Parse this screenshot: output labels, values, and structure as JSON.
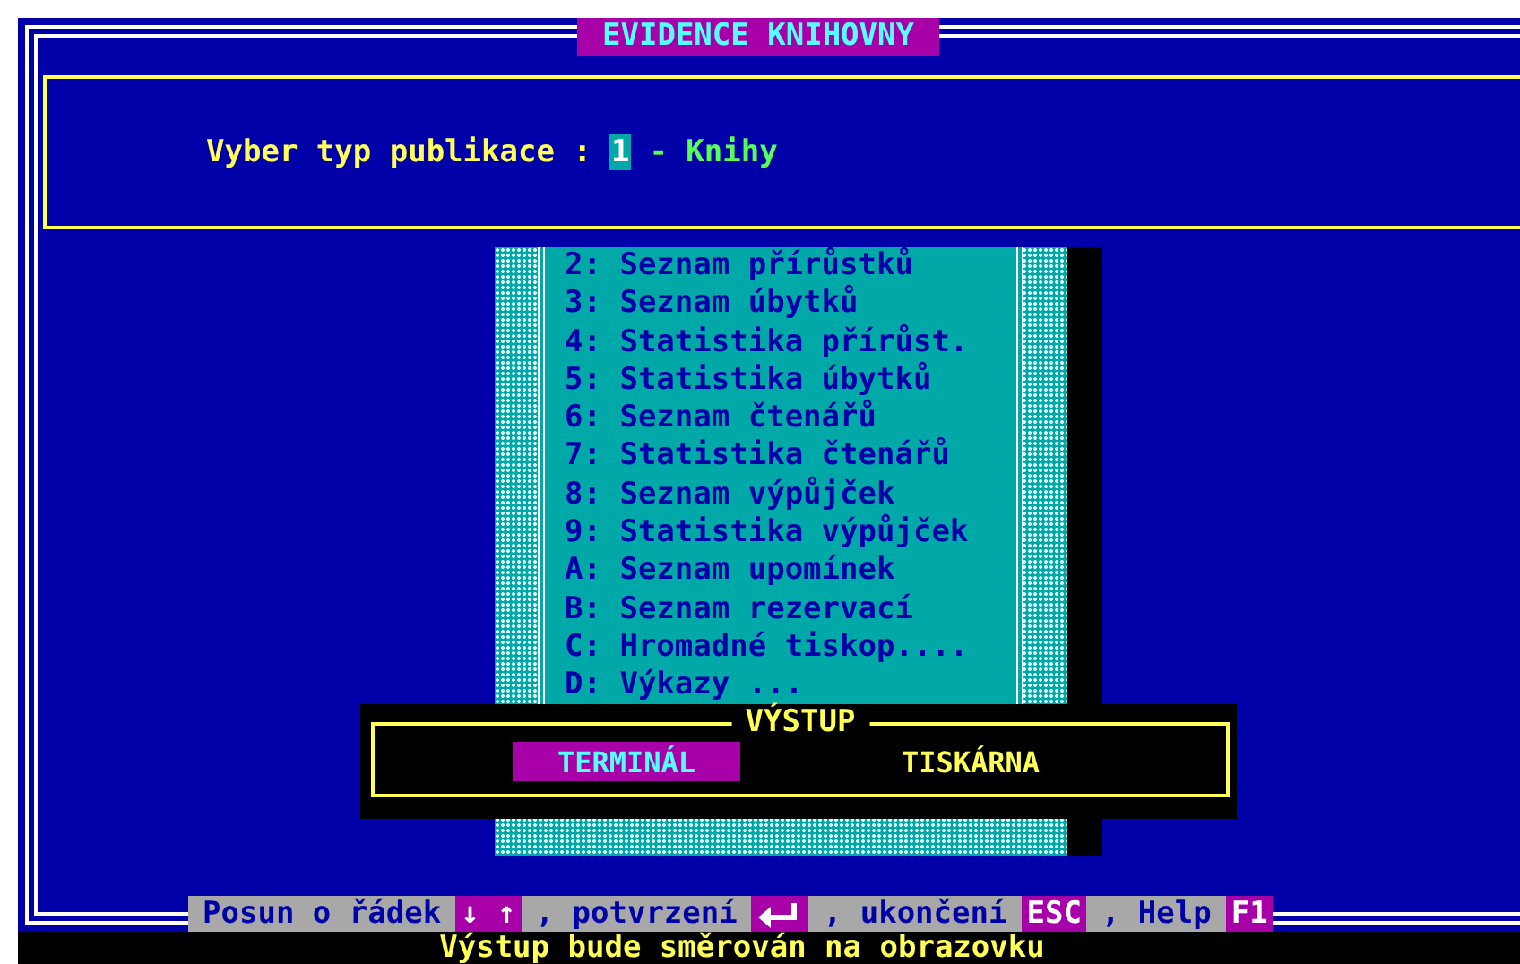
{
  "window": {
    "title": "EVIDENCE KNIHOVNY"
  },
  "prompt": {
    "label": "Vyber typ publikace :",
    "value": "1",
    "value_text": "- Knihy"
  },
  "menu": {
    "items": [
      {
        "label": "2: Seznam přírůstků"
      },
      {
        "label": "3: Seznam úbytků"
      },
      {
        "label": "4: Statistika přírůst."
      },
      {
        "label": "5: Statistika úbytků"
      },
      {
        "label": "6: Seznam čtenářů"
      },
      {
        "label": "7: Statistika čtenářů"
      },
      {
        "label": "8: Seznam výpůjček"
      },
      {
        "label": "9: Statistika výpůjček"
      },
      {
        "label": "A: Seznam upomínek"
      },
      {
        "label": "B: Seznam rezervací"
      },
      {
        "label": "C: Hromadné tiskop...."
      },
      {
        "label": "D: Výkazy ..."
      }
    ]
  },
  "dialog": {
    "title": "VÝSTUP",
    "options": [
      {
        "label": "TERMINÁL",
        "selected": true
      },
      {
        "label": "TISKÁRNA",
        "selected": false
      }
    ]
  },
  "help_bar": [
    {
      "kind": "text",
      "label": "Posun o řádek"
    },
    {
      "kind": "key",
      "label": "↓ ↑"
    },
    {
      "kind": "text",
      "label": ", potvrzení"
    },
    {
      "kind": "enter_key"
    },
    {
      "kind": "text",
      "label": ", ukončení"
    },
    {
      "kind": "key",
      "label": "ESC"
    },
    {
      "kind": "text",
      "label": ", Help"
    },
    {
      "kind": "key",
      "label": "F1"
    }
  ],
  "status_line": "Výstup bude směrován na obrazovku"
}
